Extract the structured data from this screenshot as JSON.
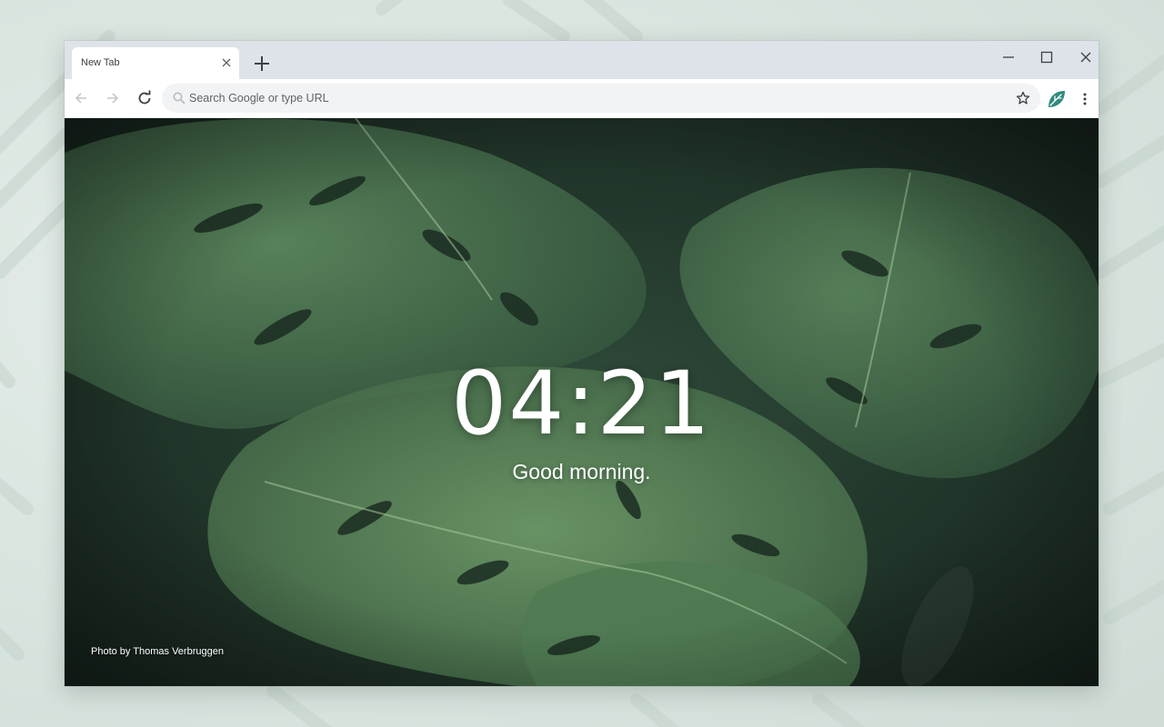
{
  "browser": {
    "tab": {
      "title": "New Tab"
    },
    "omnibox": {
      "placeholder": "Search Google or type URL"
    }
  },
  "page": {
    "clock": "04:21",
    "greeting": "Good morning.",
    "photo_credit": "Photo by Thomas Verbruggen"
  },
  "icons": {
    "tab_close": "close-icon",
    "new_tab": "plus-icon",
    "minimize": "minimize-icon",
    "maximize": "maximize-icon",
    "close_window": "close-icon",
    "back": "arrow-left-icon",
    "forward": "arrow-right-icon",
    "reload": "reload-icon",
    "search": "search-icon",
    "bookmark": "star-icon",
    "extension": "leaf-icon",
    "menu": "more-vert-icon"
  },
  "colors": {
    "tabstrip": "#dee3e9",
    "omnibox": "#f1f3f4",
    "extension_accent": "#2f8a7e",
    "text_dim": "#5f6368"
  }
}
